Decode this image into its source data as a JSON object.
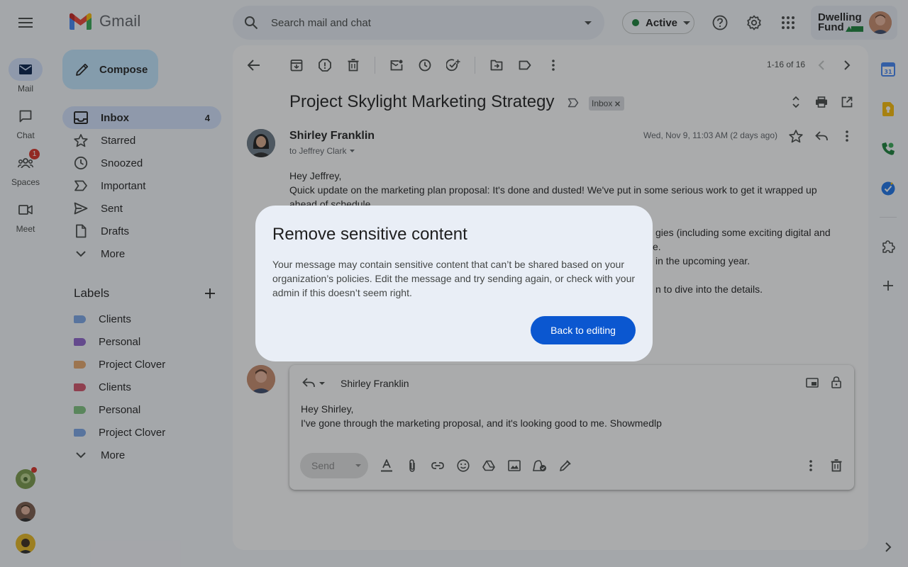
{
  "app": {
    "title": "Gmail"
  },
  "search": {
    "placeholder": "Search mail and chat"
  },
  "status": {
    "label": "Active",
    "color": "#188038"
  },
  "org": {
    "line1": "Dwelling",
    "line2": "Fund"
  },
  "rail": {
    "items": [
      {
        "label": "Mail",
        "icon": "mail-icon"
      },
      {
        "label": "Chat",
        "icon": "chat-icon"
      },
      {
        "label": "Spaces",
        "icon": "spaces-icon",
        "badge": "1"
      },
      {
        "label": "Meet",
        "icon": "meet-icon"
      }
    ]
  },
  "compose": {
    "label": "Compose"
  },
  "nav": {
    "items": [
      {
        "label": "Inbox",
        "count": "4",
        "icon": "inbox-icon"
      },
      {
        "label": "Starred",
        "icon": "star-icon"
      },
      {
        "label": "Snoozed",
        "icon": "clock-icon"
      },
      {
        "label": "Important",
        "icon": "important-icon"
      },
      {
        "label": "Sent",
        "icon": "send-icon"
      },
      {
        "label": "Drafts",
        "icon": "draft-icon"
      },
      {
        "label": "More",
        "icon": "chevron-down-icon"
      }
    ]
  },
  "labels": {
    "title": "Labels",
    "items": [
      {
        "label": "Clients",
        "color": "#7ba7e8"
      },
      {
        "label": "Personal",
        "color": "#8e63ce"
      },
      {
        "label": "Project Clover",
        "color": "#e8a96b"
      },
      {
        "label": "Clients",
        "color": "#d3536a"
      },
      {
        "label": "Personal",
        "color": "#7ec47e"
      },
      {
        "label": "Project Clover",
        "color": "#7ba7e8"
      }
    ],
    "more": "More"
  },
  "toolbar": {
    "pager": "1-16 of 16"
  },
  "email": {
    "subject": "Project Skylight Marketing Strategy",
    "chip": "Inbox",
    "sender": "Shirley Franklin",
    "to": "to Jeffrey Clark",
    "date": "Wed, Nov 9, 11:03 AM (2 days ago)",
    "body": [
      "Hey Jeffrey,",
      "Quick update on the marketing plan proposal: It's done and dusted! We've put in some serious work to get it wrapped up",
      "ahead of schedule.",
      "gies (including some exciting digital and",
      "e.",
      "in the upcoming year.",
      "n to dive into the details."
    ]
  },
  "reply": {
    "to": "Shirley Franklin",
    "lines": [
      "Hey Shirley,",
      "I've gone through the marketing proposal, and it's looking good to me. Showmedlp"
    ],
    "send_label": "Send"
  },
  "dialog": {
    "title": "Remove sensitive content",
    "body": "Your message may contain sensitive content that can’t be shared based on your organization’s policies. Edit the message and try sending again, or check with your admin if this doesn’t seem right.",
    "button": "Back to editing"
  },
  "colors": {
    "accent": "#0b57d0",
    "nav_active": "#d3e3fd",
    "compose": "#c2e7ff"
  }
}
